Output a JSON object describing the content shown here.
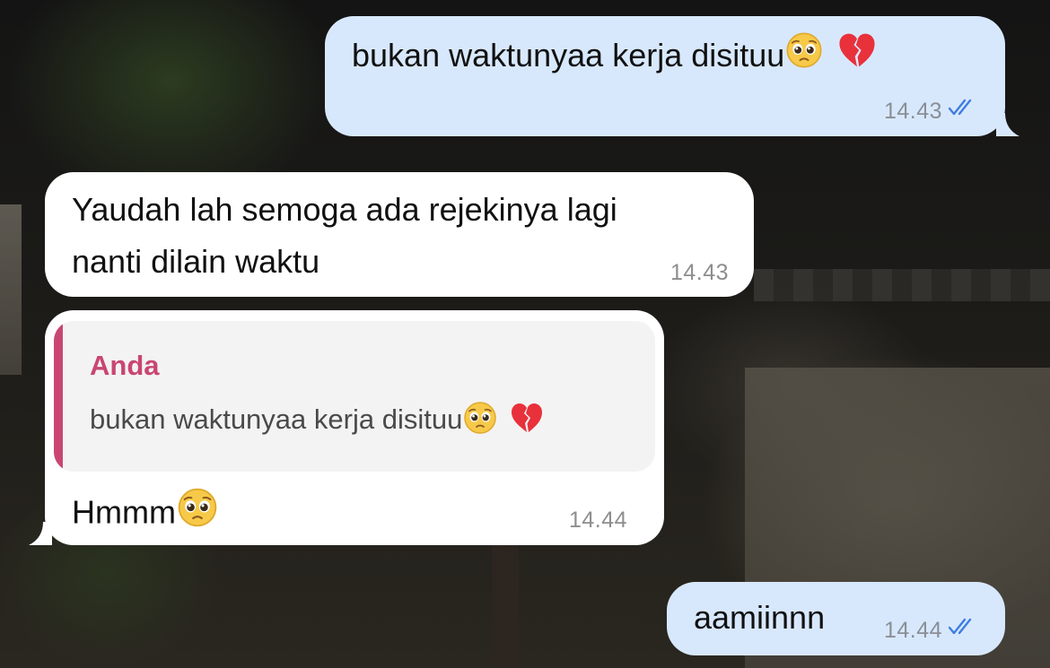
{
  "messages": [
    {
      "direction": "outgoing",
      "text": "bukan waktunyaa kerja disituu",
      "emojis": [
        "pleading-face",
        "broken-heart"
      ],
      "time": "14.43",
      "status": "read"
    },
    {
      "direction": "incoming",
      "lines": [
        "Yaudah lah semoga ada rejekinya lagi",
        "nanti dilain waktu"
      ],
      "time": "14.43"
    },
    {
      "direction": "incoming",
      "reply_to": {
        "author": "Anda",
        "text": "bukan waktunyaa kerja disituu",
        "emojis": [
          "pleading-face",
          "broken-heart"
        ]
      },
      "text": "Hmmm",
      "emojis": [
        "pleading-face"
      ],
      "time": "14.44"
    },
    {
      "direction": "outgoing",
      "text": "aamiinnn",
      "time": "14.44",
      "status": "read"
    }
  ],
  "colors": {
    "outgoing_bubble": "#d8e8fc",
    "incoming_bubble": "#ffffff",
    "read_ticks": "#3f7de0",
    "quote_accent": "#c94673",
    "timestamp": "#8a8f96"
  }
}
